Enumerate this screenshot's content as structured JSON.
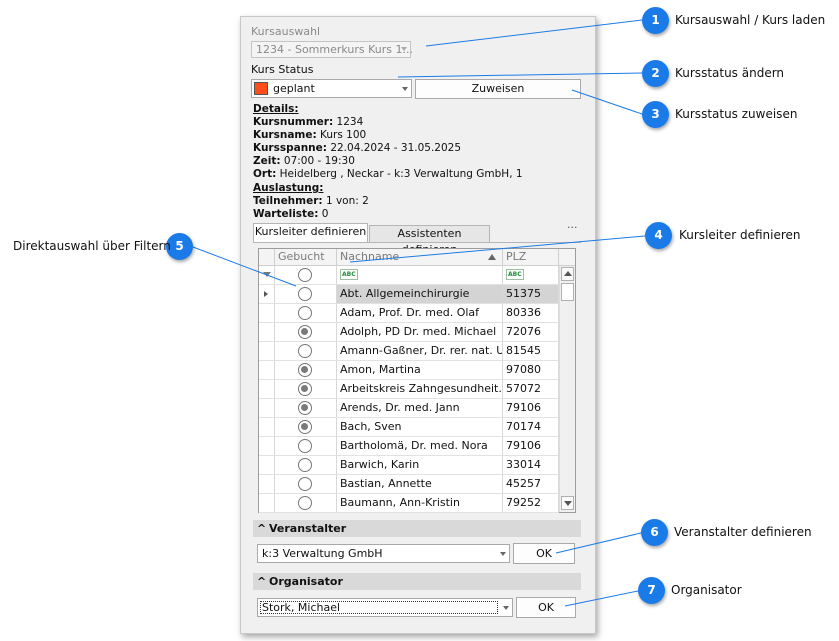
{
  "panel": {
    "kursauswahl_label": "Kursauswahl",
    "kursauswahl_value": "1234 - Sommerkurs Kurs 1...",
    "kurs_status_label": "Kurs Status",
    "status_value": "geplant",
    "status_color": "#ff4e1a",
    "zuweisen_label": "Zuweisen",
    "details": {
      "heading": "Details:",
      "kursnummer_key": "Kursnummer:",
      "kursnummer_val": " 1234",
      "kursname_key": "Kursname:",
      "kursname_val": " Kurs 100",
      "kursspanne_key": "Kursspanne:",
      "kursspanne_val": " 22.04.2024 - 31.05.2025",
      "zeit_key": "Zeit:",
      "zeit_val": " 07:00 - 19:30",
      "ort_key": "Ort:",
      "ort_val": " Heidelberg , Neckar - k:3 Verwaltung GmbH, 1"
    },
    "auslastung": {
      "heading": "Auslastung:",
      "teilnehmer_key": "Teilnehmer:",
      "teilnehmer_val": " 1 von: 2",
      "warteliste_key": "Warteliste:",
      "warteliste_val": " 0"
    },
    "tabs": [
      "Kursleiter definieren",
      "Assistenten definieren"
    ],
    "tabs_more": "···",
    "grid": {
      "columns": [
        "Gebucht",
        "Nachname",
        "PLZ"
      ],
      "filter_icon_text": "ABC",
      "rows": [
        {
          "booked": false,
          "name": "Abt. Allgemeinchirurgie",
          "plz": "51375"
        },
        {
          "booked": false,
          "name": "Adam, Prof. Dr. med. Olaf",
          "plz": "80336"
        },
        {
          "booked": true,
          "name": "Adolph, PD Dr. med.  Michael",
          "plz": "72076"
        },
        {
          "booked": false,
          "name": "Amann-Gaßner, Dr. rer. nat. U...",
          "plz": "81545"
        },
        {
          "booked": true,
          "name": "Amon, Martina",
          "plz": "97080"
        },
        {
          "booked": true,
          "name": "Arbeitskreis Zahngesundheit...",
          "plz": "57072"
        },
        {
          "booked": true,
          "name": "Arends, Dr. med. Jann",
          "plz": "79106"
        },
        {
          "booked": true,
          "name": "Bach, Sven",
          "plz": "70174"
        },
        {
          "booked": false,
          "name": "Bartholomä, Dr. med. Nora",
          "plz": "79106"
        },
        {
          "booked": false,
          "name": "Barwich, Karin",
          "plz": "33014"
        },
        {
          "booked": false,
          "name": "Bastian, Annette",
          "plz": "45257"
        },
        {
          "booked": false,
          "name": "Baumann, Ann-Kristin",
          "plz": "79252"
        }
      ]
    },
    "veranstalter": {
      "heading": "Veranstalter",
      "value": "k:3 Verwaltung GmbH",
      "ok_label": "OK"
    },
    "organisator": {
      "heading": "Organisator",
      "value": "Stork, Michael",
      "ok_label": "OK"
    }
  },
  "callouts": [
    {
      "num": "1",
      "text": "Kursauswahl / Kurs laden"
    },
    {
      "num": "2",
      "text": "Kursstatus ändern"
    },
    {
      "num": "3",
      "text": "Kursstatus zuweisen"
    },
    {
      "num": "4",
      "text": "Kursleiter definieren"
    },
    {
      "num": "5",
      "text": "Direktauswahl über Filtern"
    },
    {
      "num": "6",
      "text": "Veranstalter definieren"
    },
    {
      "num": "7",
      "text": "Organisator"
    }
  ],
  "colors": {
    "callout": "#1a7be8",
    "selected_row": "#d4d4d4"
  }
}
